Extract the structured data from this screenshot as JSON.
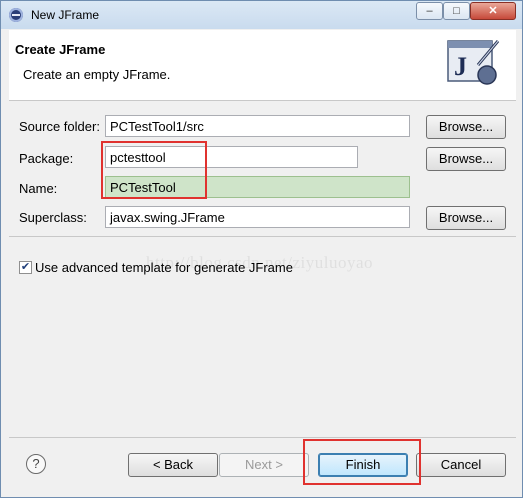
{
  "window": {
    "title": "New JFrame",
    "controls": {
      "minimize": "–",
      "maximize": "□",
      "close": "✕"
    }
  },
  "banner": {
    "title": "Create JFrame",
    "description": "Create an empty JFrame.",
    "image_letter": "J"
  },
  "form": {
    "source_folder": {
      "label": "Source folder:",
      "value": "PCTestTool1/src",
      "button": "Browse..."
    },
    "package": {
      "label": "Package:",
      "value": "pctesttool",
      "button": "Browse..."
    },
    "name": {
      "label": "Name:",
      "value": "PCTestTool"
    },
    "superclass": {
      "label": "Superclass:",
      "value": "javax.swing.JFrame",
      "button": "Browse..."
    },
    "advanced_template": {
      "label": "Use advanced template for generate JFrame",
      "checked": true,
      "mark": "✔"
    }
  },
  "watermark": "http://blog.csdn.net/ziyuluoyao",
  "footer": {
    "help": "?",
    "back": "< Back",
    "next": "Next >",
    "finish": "Finish",
    "cancel": "Cancel"
  },
  "colors": {
    "title_bar": "#c9dbee",
    "highlight_field": "#cfe4c9",
    "annotation_box": "#e0322f",
    "default_button": "#bee6fd"
  }
}
